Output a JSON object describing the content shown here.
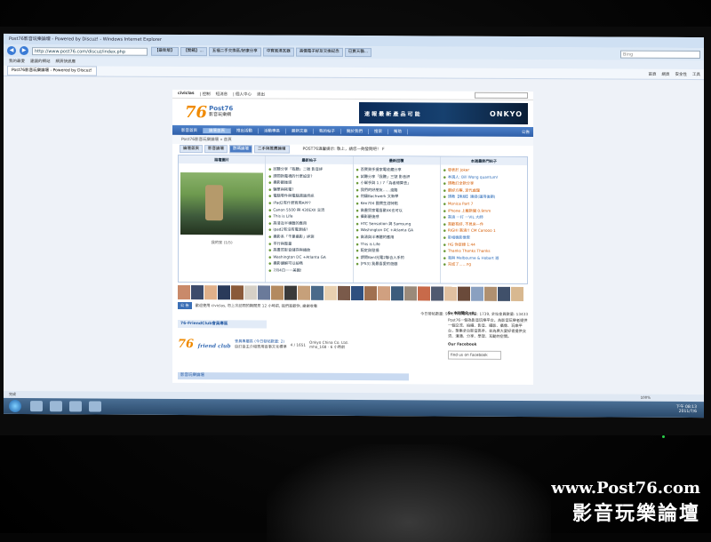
{
  "browser": {
    "window_title": "Post76影音玩樂論壇 - Powered by Discuz! - Windows Internet Explorer",
    "url": "http://www.post76.com/discuz/index.php",
    "search_placeholder": "Bing",
    "tabs": [
      "【最新版】",
      "【開箱】...",
      "五福二手交換區/好康分享",
      "中寶風清瓦器",
      "高價電子好友交換記念",
      "已買天貓..."
    ],
    "favorites": [
      "我的最愛",
      "建議的網站",
      "網頁快訊庫"
    ],
    "page_tab": "Post76影音玩樂論壇 - Powered by Discuz!",
    "tools": [
      "首頁",
      "網頁",
      "安全性",
      "工具"
    ]
  },
  "site": {
    "toplinks": [
      "civiclas",
      "| 控制",
      "短消息",
      "| 個人中心",
      "退出"
    ],
    "logo_number": "76",
    "logo_name": "Post76",
    "logo_sub": "影音玩樂網",
    "banner_text": "速 報 最 新 產 品 可 能",
    "banner_brand": "ONKYO",
    "nav": [
      "影音首頁",
      "論壇首頁",
      "推出活動",
      "活動專區",
      "最新文章",
      "我的帖子",
      "關於我們",
      "搜索",
      "幫助"
    ],
    "nav_active_index": 1,
    "announcement": "公告",
    "breadcrumb": "Post76影音玩樂論壇 » 首頁",
    "subtabs": [
      "論壇首頁",
      "影音論壇",
      "數碼論壇",
      "二手與推薦論壇"
    ],
    "subtab_active_index": 2,
    "notice": "POST76溫馨提示: 敬上，請您一夠發問吧！ F"
  },
  "board": {
    "col1_title": "論壇圖片",
    "col1_caption": "我的家 (1/5)",
    "col2_title": "最新帖子",
    "col2_items": [
      "試聽分享「我聽」二號 影音評",
      "請問新電視的什麼設定?",
      "攝影觀後感",
      "騙單與耗電?",
      "電腦零件與電腦週邊資訊",
      "iPad2有什麼實用APP?",
      "Canon 5500 與 430EXII 交流",
      "This is Life",
      "高清及半導體的應用",
      "ipad2有沒有電源插?",
      "攝影系「千里攝影」評測",
      "平行與整量",
      "高畫質影音儲存與播放",
      "Washington DC +Atlanta GA",
      "攝影講解可以拍嗎",
      "7月4日一一美國!"
    ],
    "col3_title": "最新回覆",
    "col3_items": [
      "百寶買手提家電收藏分享",
      "試聽分享「我聽」三號 影音評",
      "小幫手與 1 / 7「為者總算去」",
      "我們的好朋友……遠路",
      "何讓Bachwerk 文新學",
      "Ken704 國寶生涯特點",
      "高畫質家電喜歡4K也可以",
      "攝影觀後感",
      "HTC Sensation 與 Samsung",
      "Washington DC +Atlanta GA",
      "高清與半導體的應用",
      "This is Life",
      "配定與發揚",
      "請問Kenl光電2聯合入手的",
      "[PS3] 我最喜愛的遊戲"
    ],
    "col4_title": "本週最熱門帖子",
    "col4_items": [
      "發表於 Joker",
      "本週人: Bill Wong quantum!",
      "請教訂全新分享",
      "最好方案, 定代處理",
      "請教【無線】連接(運用後期)",
      "Monica Part 7",
      "iPhone 上戴新聞 0.9mm",
      "高清 一打 一VIL 大師",
      "喜歡有好, 不見來一件",
      "RIGHI 高清!! CM Canooo 1",
      "影相機影像思",
      "HG 你定錄 1:44",
      "Thanks Thanks Thanks",
      "我與 Melbourne & Hobart 遊",
      "完成了……ng"
    ]
  },
  "stats": {
    "welcome_btn": "公 告",
    "welcome_text": "歡迎使用 civiclas, 勿上次訪問的期間是 12 小時前, 我們喜歡你, 謝謝收看",
    "online_text": "今日發帖數量: 954, 昨日發帖數量: 1739, 全站會員數量: 13433"
  },
  "friend": {
    "head": "76-FriendClub會員專區",
    "logo": "76",
    "logo_sub": "friend club",
    "info": "會員專屬區 (今日發帖數量: 2)",
    "info2": "自訂自主介紹實用百事文化標準",
    "count": "4 / 1651",
    "company": "Onkyo China Co. Ltd.",
    "company_sub": "mho_168 - 6 小時前"
  },
  "right_box": {
    "title": "9+本站簡介+9",
    "text": "Post76一個為影音玩樂平台，為影音玩樂者提供一個交流、拍攝、影音、攝影、攝像、玩樂平台，聚集全台影音高手、並為廣大愛好者提供交流、溝通、分享、學習、互動的空間。",
    "facebook": "Our Facebook",
    "facebook_btn": "find us on Facebook"
  },
  "forum_head": "影音玩樂論壇",
  "status": {
    "text": "完成",
    "zoom": "100%"
  },
  "clock": {
    "time": "下午 08:13",
    "date": "2011/7/6"
  },
  "watermark": {
    "url": "www.Post76.com",
    "name": "影音玩樂論壇"
  },
  "avatar_colors": [
    "#c98a6a",
    "#3d4b6b",
    "#e0b08a",
    "#2a3a5a",
    "#8a5a3a",
    "#d6d0c6",
    "#6a7a9a",
    "#b38a60",
    "#3a3a3a",
    "#c6a07a",
    "#4a6a8a",
    "#e8d0b0",
    "#7a5a4a",
    "#2f4f7f",
    "#a07050",
    "#d0a080",
    "#3c5c7c",
    "#9a8a7a",
    "#c86a4a",
    "#505a70",
    "#e0c0a0",
    "#6a4a3a",
    "#8aa0c0",
    "#b09070",
    "#40506a",
    "#d8b890"
  ]
}
